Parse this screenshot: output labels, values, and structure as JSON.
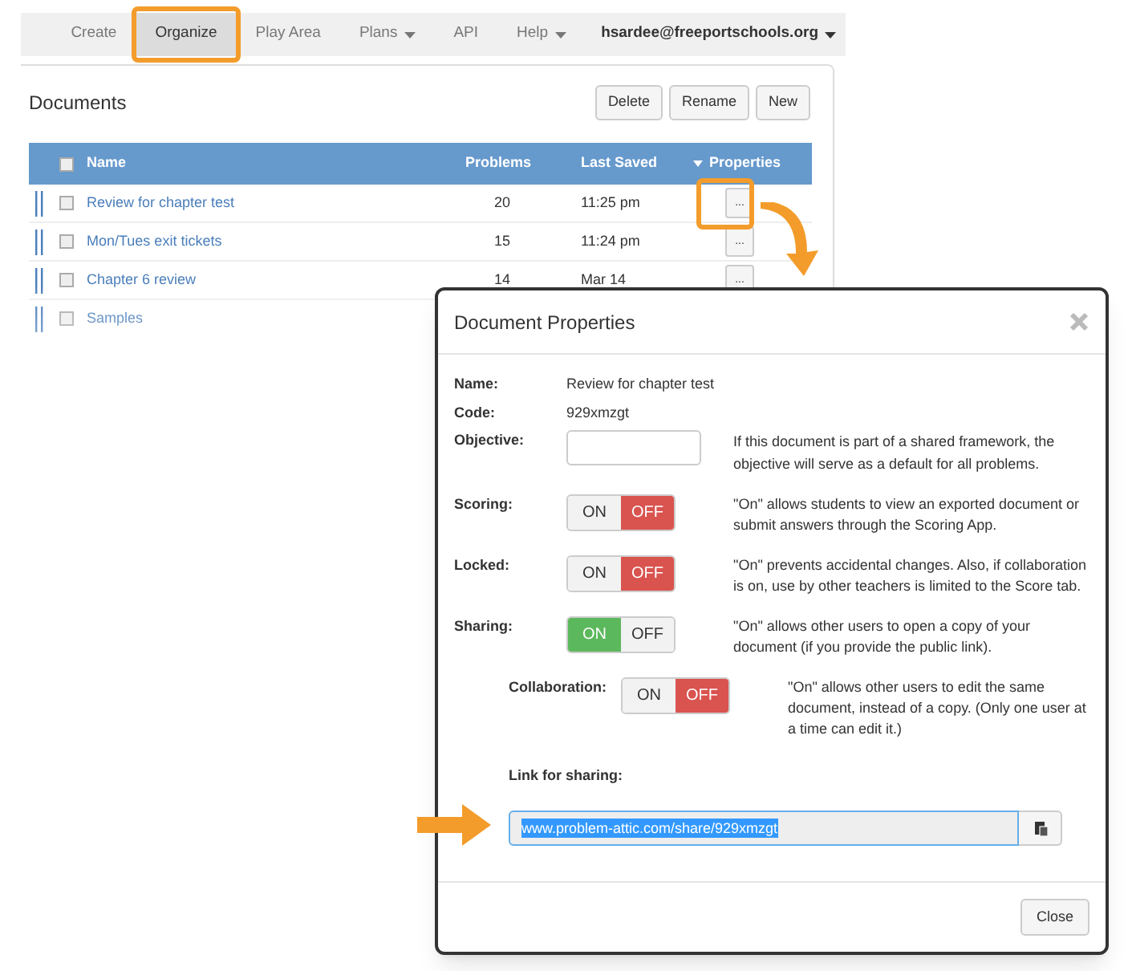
{
  "nav": {
    "items": [
      {
        "label": "Create",
        "selected": false,
        "dropdown": false
      },
      {
        "label": "Organize",
        "selected": true,
        "dropdown": false
      },
      {
        "label": "Play Area",
        "selected": false,
        "dropdown": false
      },
      {
        "label": "Plans",
        "selected": false,
        "dropdown": true
      },
      {
        "label": "API",
        "selected": false,
        "dropdown": false
      },
      {
        "label": "Help",
        "selected": false,
        "dropdown": true
      }
    ],
    "account": "hsardee@freeportschools.org"
  },
  "documents": {
    "title": "Documents",
    "buttons": [
      "Delete",
      "Rename",
      "New"
    ],
    "select_all_checked": false,
    "columns": [
      "Name",
      "Problems",
      "Last Saved",
      "Properties"
    ],
    "rows": [
      {
        "name": "Review for chapter test",
        "problems": "20",
        "last_saved": "11:25 pm",
        "properties_button": "...",
        "checked": false
      },
      {
        "name": "Mon/Tues exit tickets",
        "problems": "15",
        "last_saved": "11:24 pm",
        "properties_button": "...",
        "checked": false
      },
      {
        "name": "Chapter 6 review",
        "problems": "14",
        "last_saved": "Mar 14",
        "properties_button": "...",
        "checked": false
      },
      {
        "name": "Samples",
        "checked": false
      }
    ]
  },
  "dialog": {
    "title": "Document Properties",
    "name_label": "Name:",
    "name_value": "Review for chapter test",
    "code_label": "Code:",
    "code_value": "929xmzgt",
    "objective": {
      "label": "Objective:",
      "description": "If this document is part of a shared framework, the objective will serve as a default for all problems."
    },
    "toggles": [
      {
        "label": "Scoring:",
        "on": false,
        "indented": false,
        "on_label": "ON",
        "off_label": "OFF",
        "description": "\"On\" allows students to view an exported document or submit answers through the Scoring App."
      },
      {
        "label": "Locked:",
        "on": false,
        "indented": false,
        "on_label": "ON",
        "off_label": "OFF",
        "description": "\"On\" prevents accidental changes. Also, if collaboration is on, use by other teachers is limited to the Score tab."
      },
      {
        "label": "Sharing:",
        "on": true,
        "indented": false,
        "on_label": "ON",
        "off_label": "OFF",
        "description": "\"On\" allows other users to open a copy of your document (if you provide the public link)."
      },
      {
        "label": "Collaboration:",
        "on": false,
        "indented": true,
        "on_label": "ON",
        "off_label": "OFF",
        "description": "\"On\" allows other users to edit the same document, instead of a copy. (Only one user at a time can edit it.)"
      }
    ],
    "link_label": "Link for sharing:",
    "link_value": "www.problem-attic.com/share/929xmzgt",
    "close": "Close"
  }
}
